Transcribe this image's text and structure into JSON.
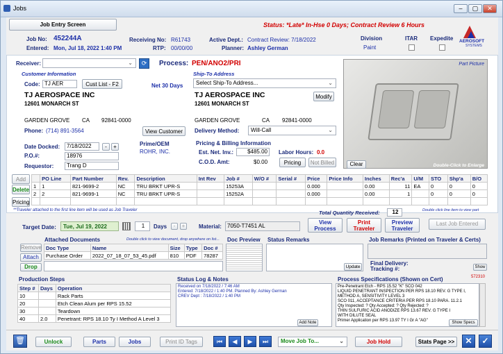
{
  "window": {
    "title": "Jobs"
  },
  "header": {
    "screen_button": "Job Entry Screen",
    "status_text": "Status: *Late* In-Hse 0 Days;  Contract Review 6 Hours"
  },
  "job": {
    "job_no_label": "Job No:",
    "job_no": "452244A",
    "entered_label": "Entered:",
    "entered": "Mon, Jul 18, 2022   1:40 PM",
    "receiving_label": "Receiving No:",
    "receiving": "R61743",
    "rtp_label": "RTP:",
    "rtp": "00/00/00",
    "active_label": "Active Dept.:",
    "active": "Contract Review: 7/18/2022",
    "planner_label": "Planner:",
    "planner": "Ashley German",
    "division_label": "Division",
    "division": "Paint",
    "itar_label": "ITAR",
    "expedite_label": "Expedite"
  },
  "logo": {
    "text": "AEROSOFT",
    "sub": "SYSTEMS"
  },
  "receiver": {
    "label": "Receiver:",
    "value": ""
  },
  "process": {
    "label": "Process:",
    "value": "PEN/ANO2/PRI"
  },
  "customer": {
    "section": "Customer Information",
    "code_label": "Code:",
    "code": "TJ AER",
    "list_button": "Cust List - F2",
    "terms": "Net 30 Days",
    "name": "TJ AEROSPACE INC",
    "address": "12601 MONARCH ST",
    "city": "GARDEN GROVE",
    "state": "CA",
    "zip": "92841-0000",
    "phone_label": "Phone:",
    "phone": "(714) 891-3564",
    "view_button": "View Customer"
  },
  "shipto": {
    "section": "Ship-To Address",
    "select": "Select Ship-To Address...",
    "name": "TJ AEROSPACE INC",
    "modify_button": "Modify",
    "address": "12601 MONARCH ST",
    "city": "GARDEN GROVE",
    "state": "CA",
    "zip": "92841-0000",
    "delivery_label": "Delivery Method:",
    "delivery": "Will-Call"
  },
  "dates": {
    "docked_label": "Date Docked:",
    "docked": "7/18/2022",
    "po_label": "P.O.#:",
    "po": "18976",
    "requestor_label": "Requestor:",
    "requestor": "Trang D",
    "prime_label": "Prime/OEM",
    "prime": "ROHR, INC."
  },
  "pricing": {
    "section": "Pricing & Billing Information",
    "net_label": "Est. Net. Inv.:",
    "net": "$485.00",
    "cod_label": "C.O.D. Amt:",
    "cod": "$0.00",
    "labor_label": "Labor Hours:",
    "labor": "0.0",
    "pricing_button": "Pricing",
    "notbilled_button": "Not Billed"
  },
  "picture": {
    "label": "Part Picture",
    "clear": "Clear",
    "hint": "Double-Click to Enlarge"
  },
  "parts": {
    "side_buttons": [
      "Add",
      "Delete",
      "Pricing"
    ],
    "columns": [
      "PO Line",
      "Part Number",
      "Rev.",
      "Description",
      "Int Rev",
      "Job #",
      "W/O #",
      "Serial #",
      "Price",
      "Price Info",
      "Inches",
      "Rec'a",
      "U/M",
      "STO",
      "Shp'a",
      "B/O"
    ],
    "rows": [
      [
        "1",
        "1",
        "821-9699-2",
        "NC",
        "TRU BRKT UPR-S",
        "",
        "15253A",
        "",
        "",
        "0.000",
        "",
        "0.00",
        "11",
        "EA",
        "0",
        "0",
        "0"
      ],
      [
        "2",
        "2",
        "821-9699-1",
        "NC",
        "TRU BRKT UPR-S",
        "",
        "15252A",
        "",
        "",
        "0.000",
        "",
        "0.00",
        "1",
        "",
        "0",
        "0",
        "0"
      ]
    ],
    "traveler_note": "**Traveler attached to the first line item will be used as Job Traveler",
    "total_label": "Total Quantity Received:",
    "total": "12",
    "view_part_note": "Double click line item to view part"
  },
  "target": {
    "label": "Target Date:",
    "date": "Tue, Jul 19, 2022",
    "days": "1",
    "days_label": "Days",
    "material_label": "Material:",
    "material": "7050-T7451 AL",
    "view_process": "View Process",
    "print_traveler": "Print Traveler",
    "preview_traveler": "Preview Traveler",
    "last_job": "Last Job Entered"
  },
  "documents": {
    "section": "Attached Documents",
    "hint": "Double click to view document, drop anywhere on list...",
    "side_buttons": [
      "Remove",
      "Attach",
      "Drop"
    ],
    "columns": [
      "Doc Type",
      "Name",
      "Size",
      "Type",
      "Doc #"
    ],
    "rows": [
      [
        "Purchase Order",
        "2022_07_18_07_53_45.pdf",
        "810",
        "PDF",
        "78287"
      ]
    ],
    "preview_label": "Doc Preview"
  },
  "status_remarks": {
    "label": "Status Remarks",
    "update": "Update"
  },
  "job_remarks": {
    "label": "Job Remarks (Printed on Traveler & Certs)",
    "final_delivery": "Final Delivery:",
    "tracking": "Tracking #:",
    "show": "Show"
  },
  "steps": {
    "section": "Production Steps",
    "columns": [
      "Step #",
      "Days",
      "Operation"
    ],
    "rows": [
      [
        "10",
        "",
        "Rack Parts"
      ],
      [
        "20",
        "",
        "Etch Clean Alum per RPS 15.52"
      ],
      [
        "30",
        "",
        "Teardown"
      ],
      [
        "40",
        "2.0",
        "Penetrant: RPS 18.10 Ty I Method A Level 3"
      ]
    ]
  },
  "log": {
    "section": "Status Log & Notes",
    "lines": [
      "Received on 7/18/2022 / 7:46 AM",
      "Entered: 7/18/2022 / 1:40 PM. Planned By: Ashley German",
      "CREV Dept : 7/18/2022 / 1:40 PM"
    ],
    "add_note": "Add Note"
  },
  "specs": {
    "section": "Process Specifications (Shown on Cert)",
    "id": "572310",
    "lines": [
      "Pre-Penetrant Etch - RPS 15.52 \"K\" SCO 042",
      "LIQUID PENETRANT INSPECTION PER RPS 18.10 REV. G TYPE I,",
      "METHOD A, SENSITIVITY LEVEL 3",
      "SCO 011, ACCEPTANCE CRITERIA PER RPS 18.10 PARA. 11.2.1",
      "Qty Inspected: ?        Qty Accepted: ?        Qty Rejected: ?",
      "THIN SULFURIC ACID ANODIZE RPS 13.67 REV. G TYPE I",
      "WITH DILUTE SEAL",
      "Primer Application per RPS 13.97 TY I Gr A \"AG\""
    ],
    "show_specs": "Show Specs"
  },
  "footer": {
    "unlock": "Unlock",
    "parts": "Parts",
    "jobs": "Jobs",
    "print_id": "Print ID Tags",
    "move_job": "Move Job To...",
    "job_hold": "Job Hold",
    "stats": "Stats Page >>"
  },
  "colors": {
    "accent_blue": "#1c2fa8",
    "alert_red": "#d20000",
    "nav_blue": "#1f4fa8",
    "green": "#1a8a1a"
  }
}
